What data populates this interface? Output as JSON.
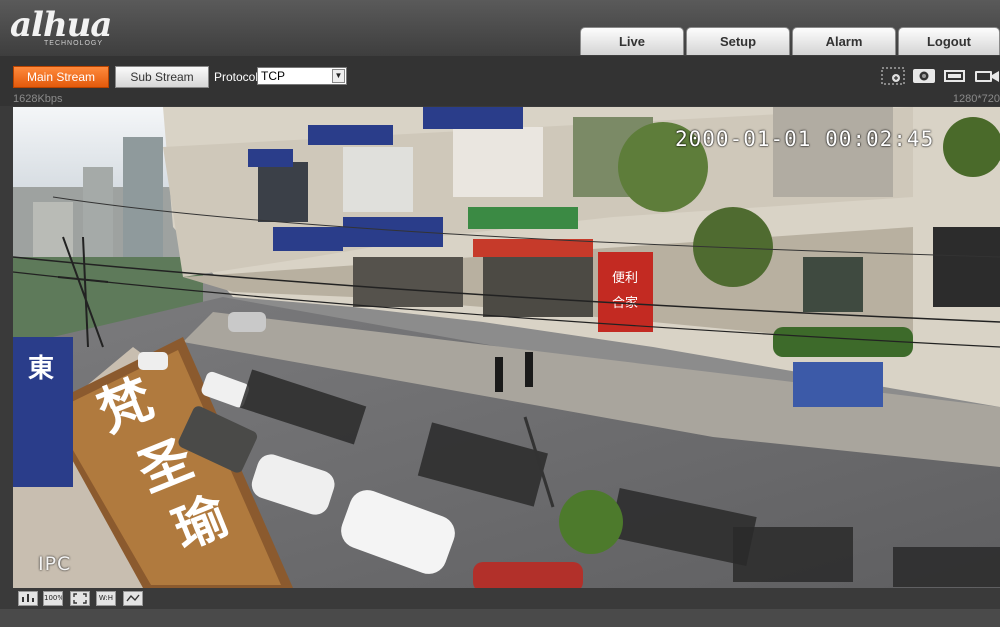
{
  "brand": {
    "logo_text": "alhua",
    "logo_sub": "TECHNOLOGY"
  },
  "nav": {
    "tabs": [
      {
        "label": "Live",
        "active": true
      },
      {
        "label": "Setup",
        "active": false
      },
      {
        "label": "Alarm",
        "active": false
      },
      {
        "label": "Logout",
        "active": false
      }
    ]
  },
  "toolbar": {
    "main_stream": "Main Stream",
    "sub_stream": "Sub Stream",
    "protocol_label": "Protocol",
    "protocol_value": "TCP",
    "bitrate": "1628Kbps",
    "resolution": "1280*720",
    "icons": [
      "digital-zoom-icon",
      "snapshot-icon",
      "triple-snapshot-icon",
      "record-icon"
    ]
  },
  "video": {
    "osd_time": "2000-01-01 00:02:45",
    "osd_name": "IPC",
    "sign_text": "梵圣瑜伽",
    "shop_sign_text": "便利店 合家欢"
  },
  "bottombar": {
    "icons": [
      {
        "name": "image-adjust-icon",
        "label": ""
      },
      {
        "name": "original-size-icon",
        "label": "100%"
      },
      {
        "name": "fullscreen-icon",
        "label": ""
      },
      {
        "name": "width-height-ratio-icon",
        "label": "W:H"
      },
      {
        "name": "smooth-playback-icon",
        "label": ""
      }
    ]
  },
  "colors": {
    "accent": "#f26b1d",
    "background": "#3a3a3a",
    "header": "#4a4a4a"
  }
}
